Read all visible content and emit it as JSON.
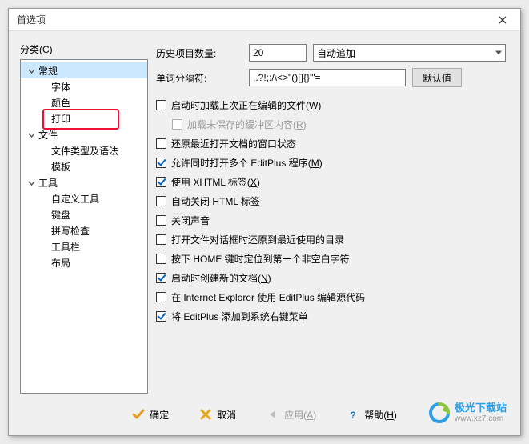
{
  "window": {
    "title": "首选项"
  },
  "sidebar": {
    "label": "分类(C)",
    "items": [
      {
        "label": "常规",
        "type": "parent",
        "expanded": true,
        "selected": true
      },
      {
        "label": "字体",
        "type": "child"
      },
      {
        "label": "颜色",
        "type": "child"
      },
      {
        "label": "打印",
        "type": "child",
        "highlight": true
      },
      {
        "label": "文件",
        "type": "parent",
        "expanded": true
      },
      {
        "label": "文件类型及语法",
        "type": "child"
      },
      {
        "label": "模板",
        "type": "child"
      },
      {
        "label": "工具",
        "type": "parent",
        "expanded": true
      },
      {
        "label": "自定义工具",
        "type": "child"
      },
      {
        "label": "键盘",
        "type": "child"
      },
      {
        "label": "拼写检查",
        "type": "child"
      },
      {
        "label": "工具栏",
        "type": "child"
      },
      {
        "label": "布局",
        "type": "child"
      }
    ]
  },
  "form": {
    "history_label": "历史项目数量:",
    "history_value": "20",
    "history_mode": "自动追加",
    "delim_label": "单词分隔符:",
    "delim_value": ",.?!;:/\\<>\"()[]{}'\"=",
    "default_btn": "默认值"
  },
  "checks": [
    {
      "label": "启动时加载上次正在编辑的文件(",
      "accel": "W",
      "tail": ")",
      "checked": false
    },
    {
      "label": "加载未保存的缓冲区内容(",
      "accel": "R",
      "tail": ")",
      "checked": false,
      "disabled": true,
      "indent": true
    },
    {
      "label": "还原最近打开文档的窗口状态",
      "checked": false
    },
    {
      "label": "允许同时打开多个 EditPlus 程序(",
      "accel": "M",
      "tail": ")",
      "checked": true
    },
    {
      "label": "使用 XHTML 标签(",
      "accel": "X",
      "tail": ")",
      "checked": true
    },
    {
      "label": "自动关闭 HTML 标签",
      "checked": false
    },
    {
      "label": "关闭声音",
      "checked": false
    },
    {
      "label": "打开文件对话框时还原到最近使用的目录",
      "checked": false
    },
    {
      "label": "按下 HOME 键时定位到第一个非空白字符",
      "checked": false
    },
    {
      "label": "启动时创建新的文档(",
      "accel": "N",
      "tail": ")",
      "checked": true
    },
    {
      "label": "在 Internet Explorer 使用 EditPlus 编辑源代码",
      "checked": false
    },
    {
      "label": "将 EditPlus 添加到系统右键菜单",
      "checked": true
    }
  ],
  "footer": {
    "ok": "确定",
    "cancel": "取消",
    "apply": "应用(",
    "apply_accel": "A",
    "apply_tail": ")",
    "help": "帮助(",
    "help_accel": "H",
    "help_tail": ")"
  },
  "watermark": {
    "line1": "极光下载站",
    "line2": "www.xz7.com"
  }
}
